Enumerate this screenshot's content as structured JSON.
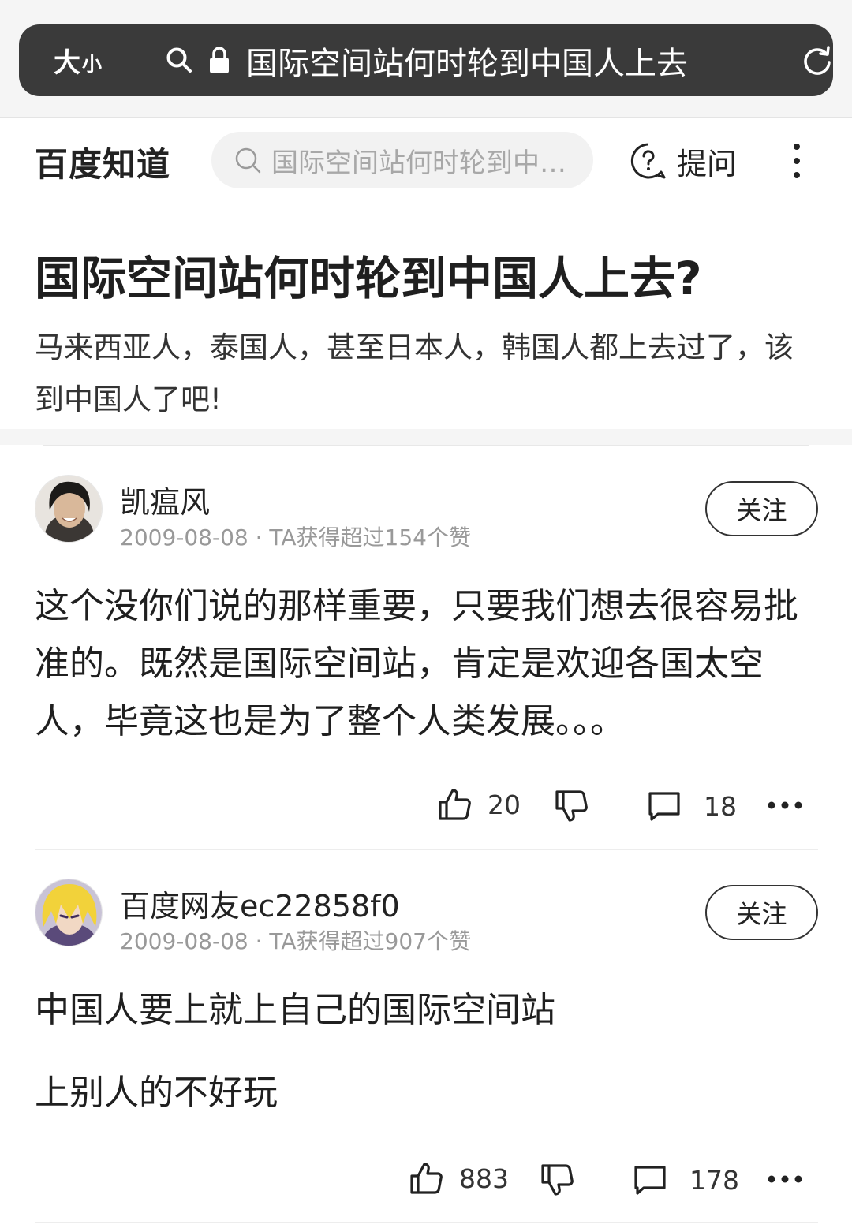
{
  "browser": {
    "font_size_big": "大",
    "font_size_small": "小",
    "url_title": "国际空间站何时轮到中国人上去"
  },
  "header": {
    "logo": "百度知道",
    "search_placeholder": "国际空间站何时轮到中…",
    "ask_label": "提问"
  },
  "question": {
    "title": "国际空间站何时轮到中国人上去?",
    "description": "马来西亚人，泰国人，甚至日本人，韩国人都上去过了，该到中国人了吧!"
  },
  "answers": [
    {
      "username": "凯瘟风",
      "meta": "2009-08-08 · TA获得超过154个赞",
      "follow_label": "关注",
      "body": [
        "这个没你们说的那样重要，只要我们想去很容易批准的。既然是国际空间站，肯定是欢迎各国太空人，毕竟这也是为了整个人类发展。。。"
      ],
      "likes": "20",
      "comments": "18"
    },
    {
      "username": "百度网友ec22858f0",
      "meta": "2009-08-08 · TA获得超过907个赞",
      "follow_label": "关注",
      "body": [
        "中国人要上就上自己的国际空间站",
        "上别人的不好玩"
      ],
      "likes": "883",
      "comments": "178"
    }
  ],
  "colors": {
    "url_bar": "#3a3a3a",
    "text_primary": "#1f1f1f",
    "text_meta": "#999999",
    "search_bg": "#f2f2f2"
  },
  "icons": [
    "search-icon",
    "lock-icon",
    "reload-icon",
    "help-circle-icon",
    "more-vertical-icon",
    "thumbs-up-icon",
    "thumbs-down-icon",
    "comment-icon",
    "more-horizontal-icon"
  ]
}
